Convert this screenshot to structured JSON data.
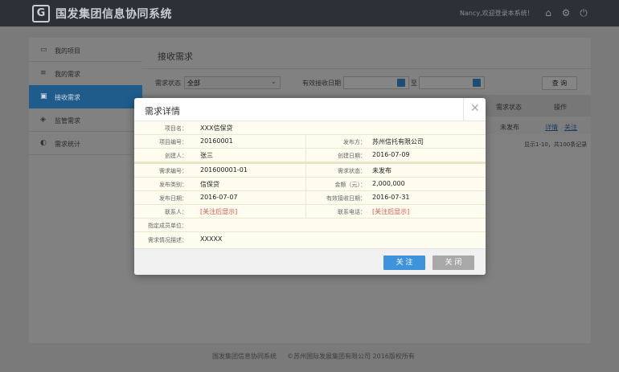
{
  "header": {
    "logo_glyph": "G",
    "app_title": "国发集团信息协同系统",
    "welcome_text": "Nancy,欢迎登录本系统！",
    "icons": [
      "home-icon",
      "settings-icon",
      "power-icon"
    ]
  },
  "sidebar": {
    "items": [
      {
        "icon": "folder-icon",
        "glyph": "▭",
        "label": "我的项目"
      },
      {
        "icon": "list-icon",
        "glyph": "≡",
        "label": "我的需求"
      },
      {
        "icon": "inbox-icon",
        "glyph": "▣",
        "label": "接收需求"
      },
      {
        "icon": "shield-icon",
        "glyph": "◈",
        "label": "监管需求"
      },
      {
        "icon": "pie-chart-icon",
        "glyph": "◐",
        "label": "需求统计"
      }
    ],
    "active_index": 2
  },
  "content": {
    "title": "接收需求",
    "filter_status_label": "需求状态",
    "filter_status_value": "全部",
    "filter_date_label": "有效接收日期",
    "filter_to_label": "至",
    "query_button": "查 询",
    "table_headers": [
      "需求状态",
      "操作"
    ],
    "row": {
      "status": "未发布",
      "action_detail": "详情",
      "action_follow": "关注"
    },
    "pager_text": "显示1-10，共100条记录"
  },
  "footer": {
    "left": "国发集团信息协同系统",
    "right": "©苏州国际发展集团有限公司 2016版权所有"
  },
  "modal": {
    "title": "需求详情",
    "close_glyph": "✕",
    "fields": {
      "project_name_label": "项目名：",
      "project_name": "XXX信保贷",
      "project_no_label": "项目编号：",
      "project_no": "20160001",
      "publisher_label": "发布方：",
      "publisher": "苏州信托有限公司",
      "creator_label": "创建人：",
      "creator": "张三",
      "created_date_label": "创建日期：",
      "created_date": "2016-07-09",
      "demand_no_label": "需求编号：",
      "demand_no": "201600001-01",
      "demand_status_label": "需求状态：",
      "demand_status": "未发布",
      "publish_type_label": "发布类别：",
      "publish_type": "信保贷",
      "amount_label": "金额（元）：",
      "amount": "2,000,000",
      "publish_date_label": "发布日期：",
      "publish_date": "2016-07-07",
      "valid_date_label": "有效接收日期：",
      "valid_date": "2016-07-31",
      "contact_label": "联系人：",
      "contact": "[关注后显示]",
      "phone_label": "联系电话：",
      "phone": "[关注后显示]",
      "member_unit_label": "指定成员单位：",
      "member_unit": "",
      "description_label": "需求情况描述：",
      "description": "XXXXX"
    },
    "follow_button": "关 注",
    "close_button": "关 闭"
  }
}
